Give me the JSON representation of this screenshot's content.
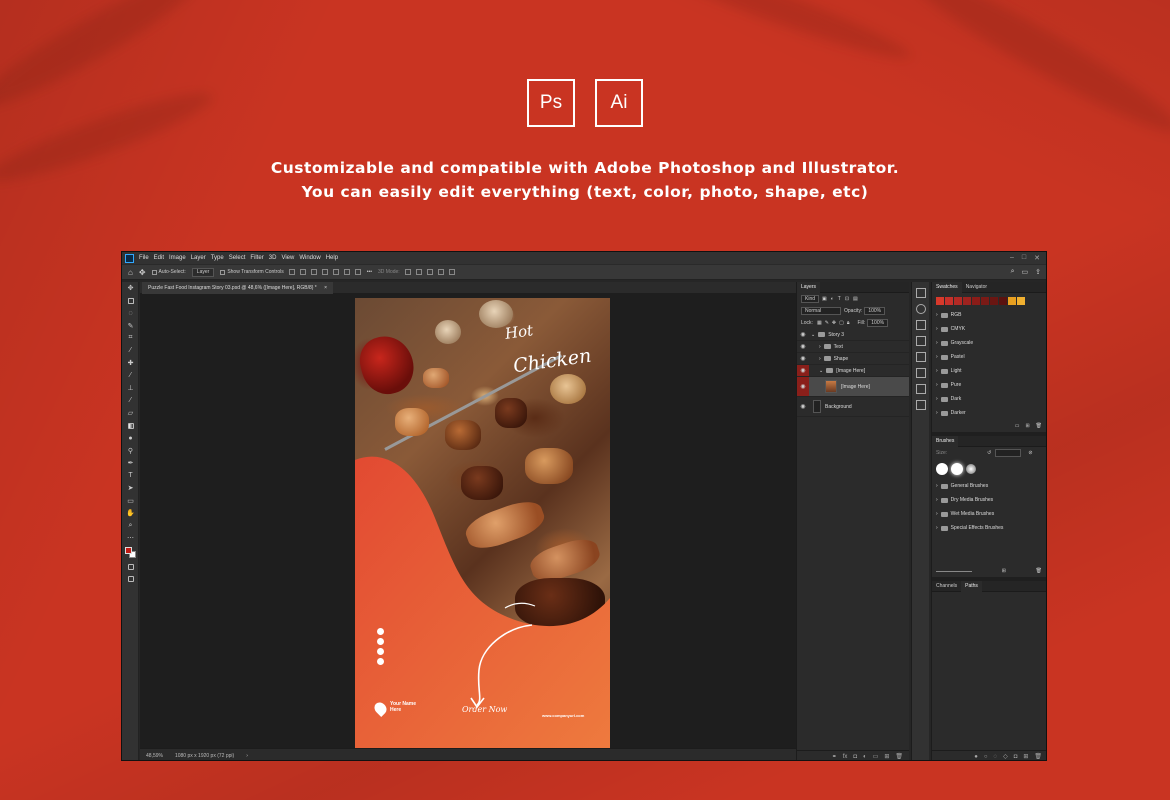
{
  "badges": {
    "ps": "Ps",
    "ai": "Ai"
  },
  "headline": {
    "line1": "Customizable and compatible with Adobe Photoshop and Illustrator.",
    "line2": "You can easily edit everything (text, color, photo, shape, etc)"
  },
  "app": {
    "menu": [
      "File",
      "Edit",
      "Image",
      "Layer",
      "Type",
      "Select",
      "Filter",
      "3D",
      "View",
      "Window",
      "Help"
    ],
    "options": {
      "auto_select": "Auto-Select:",
      "layer_value": "Layer",
      "show_transform": "Show Transform Controls",
      "mode_3d": "3D Mode:"
    },
    "document_tab": "Puzzle Fast Food Instagram Story 03.psd @ 48,6% ([Image Here], RGB/8) *",
    "status": {
      "zoom": "48,59%",
      "size": "1080 px x 1920 px (72 ppi)"
    }
  },
  "artboard": {
    "headline_line1": "Hot",
    "headline_line2": "Chicken",
    "brand": "Your Name Here",
    "cta": "Order Now",
    "website": "www.companyurl.com"
  },
  "layers_panel": {
    "tab": "Layers",
    "kind": "Kind",
    "blend_mode": "Normal",
    "opacity_label": "Opacity:",
    "opacity_value": "100%",
    "lock_label": "Lock:",
    "fill_label": "Fill:",
    "fill_value": "100%",
    "layers": [
      "Story 3",
      "Text",
      "Shape",
      "[Image Here]",
      "[Image Here]",
      "Background"
    ]
  },
  "swatches_panel": {
    "tabs": [
      "Swatches",
      "Navigator"
    ],
    "swatch_colors": [
      "#d8392b",
      "#c7302a",
      "#b22a25",
      "#9e231f",
      "#8a1c18",
      "#7a1a16",
      "#6a1612",
      "#5a120f",
      "#e8a020",
      "#f0b030"
    ],
    "groups": [
      "RGB",
      "CMYK",
      "Grayscale",
      "Pastel",
      "Light",
      "Pure",
      "Dark",
      "Darker"
    ]
  },
  "brushes_panel": {
    "tab": "Brushes",
    "size_label": "Size:",
    "groups": [
      "General Brushes",
      "Dry Media Brushes",
      "Wet Media Brushes",
      "Special Effects Brushes"
    ]
  },
  "paths_panel": {
    "tabs": [
      "Channels",
      "Paths"
    ]
  }
}
